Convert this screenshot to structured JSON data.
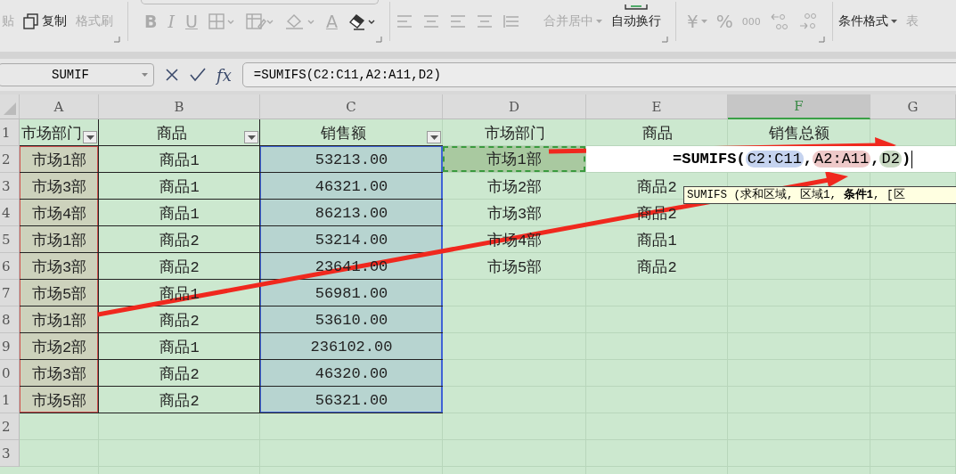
{
  "ribbon": {
    "clipboard": [
      {
        "label": "贴",
        "disabled": true
      },
      {
        "label": "复制",
        "disabled": false
      },
      {
        "label": "格式刷",
        "disabled": true
      }
    ],
    "font_styles": [
      "B",
      "I",
      "U"
    ],
    "font_color_glyph": "A",
    "alignment": [
      {
        "label": "合并居中",
        "disabled": true
      },
      {
        "label": "自动换行",
        "disabled": false
      }
    ],
    "number": [
      "¥",
      "%",
      "000"
    ],
    "styles": [
      {
        "label": "条件格式",
        "disabled": false
      },
      {
        "label": "表",
        "disabled": true
      }
    ]
  },
  "formula_bar": {
    "name_box": "SUMIF",
    "fx": "fx",
    "value": "=SUMIFS(C2:C11,A2:A11,D2)"
  },
  "columns": [
    {
      "label": "A",
      "selected": false
    },
    {
      "label": "B",
      "selected": false
    },
    {
      "label": "C",
      "selected": false
    },
    {
      "label": "D",
      "selected": false
    },
    {
      "label": "E",
      "selected": false
    },
    {
      "label": "F",
      "selected": true
    },
    {
      "label": "G",
      "selected": false
    }
  ],
  "rows": [
    {
      "number": "1",
      "cells": [
        {
          "text": "市场部门",
          "filter": true
        },
        {
          "text": "商品",
          "filter": true
        },
        {
          "text": "销售额",
          "filter": true
        },
        {
          "text": "市场部门",
          "filter": false
        },
        {
          "text": "商品",
          "filter": false
        },
        {
          "text": "销售总额",
          "filter": false
        }
      ]
    },
    {
      "number": "2",
      "cells": [
        {
          "text": "市场1部"
        },
        {
          "text": "商品1"
        },
        {
          "text": "53213.00"
        },
        {
          "text": "市场1部",
          "selected": true
        }
      ]
    },
    {
      "number": "3",
      "cells": [
        {
          "text": "市场3部"
        },
        {
          "text": "商品1"
        },
        {
          "text": "46321.00"
        },
        {
          "text": "市场2部"
        },
        {
          "text": "商品2"
        }
      ]
    },
    {
      "number": "4",
      "cells": [
        {
          "text": "市场4部"
        },
        {
          "text": "商品1"
        },
        {
          "text": "86213.00"
        },
        {
          "text": "市场3部"
        },
        {
          "text": "商品2"
        }
      ]
    },
    {
      "number": "5",
      "cells": [
        {
          "text": "市场1部"
        },
        {
          "text": "商品2"
        },
        {
          "text": "53214.00"
        },
        {
          "text": "市场4部"
        },
        {
          "text": "商品1"
        }
      ]
    },
    {
      "number": "6",
      "cells": [
        {
          "text": "市场3部"
        },
        {
          "text": "商品2"
        },
        {
          "text": "23641.00"
        },
        {
          "text": "市场5部"
        },
        {
          "text": "商品2"
        }
      ]
    },
    {
      "number": "7",
      "cells": [
        {
          "text": "市场5部"
        },
        {
          "text": "商品1"
        },
        {
          "text": "56981.00"
        }
      ]
    },
    {
      "number": "8",
      "cells": [
        {
          "text": "市场1部"
        },
        {
          "text": "商品2"
        },
        {
          "text": "53610.00"
        }
      ]
    },
    {
      "number": "9",
      "cells": [
        {
          "text": "市场2部"
        },
        {
          "text": "商品1"
        },
        {
          "text": "236102.00"
        }
      ]
    },
    {
      "number": "0",
      "cells": [
        {
          "text": "市场3部"
        },
        {
          "text": "商品2"
        },
        {
          "text": "46320.00"
        }
      ]
    },
    {
      "number": "1",
      "cells": [
        {
          "text": "市场5部"
        },
        {
          "text": "商品2"
        },
        {
          "text": "56321.00"
        }
      ]
    },
    {
      "number": "2",
      "cells": []
    },
    {
      "number": "3",
      "cells": []
    }
  ],
  "references": [
    {
      "color": "#d0534f"
    },
    {
      "color": "#3f63d6"
    }
  ],
  "editor": {
    "tokens": [
      {
        "text": "=SUMIFS("
      },
      {
        "text": "C2:C11",
        "color": "#c5d3ef"
      },
      {
        "text": ","
      },
      {
        "text": "A2:A11",
        "color": "#eec9c9"
      },
      {
        "text": ","
      },
      {
        "text": "D2",
        "color": "#c9d9c3"
      },
      {
        "text": ")"
      }
    ],
    "tooltip": "SUMIFS (求和区域, 区域1, **条件1**, [区"
  }
}
